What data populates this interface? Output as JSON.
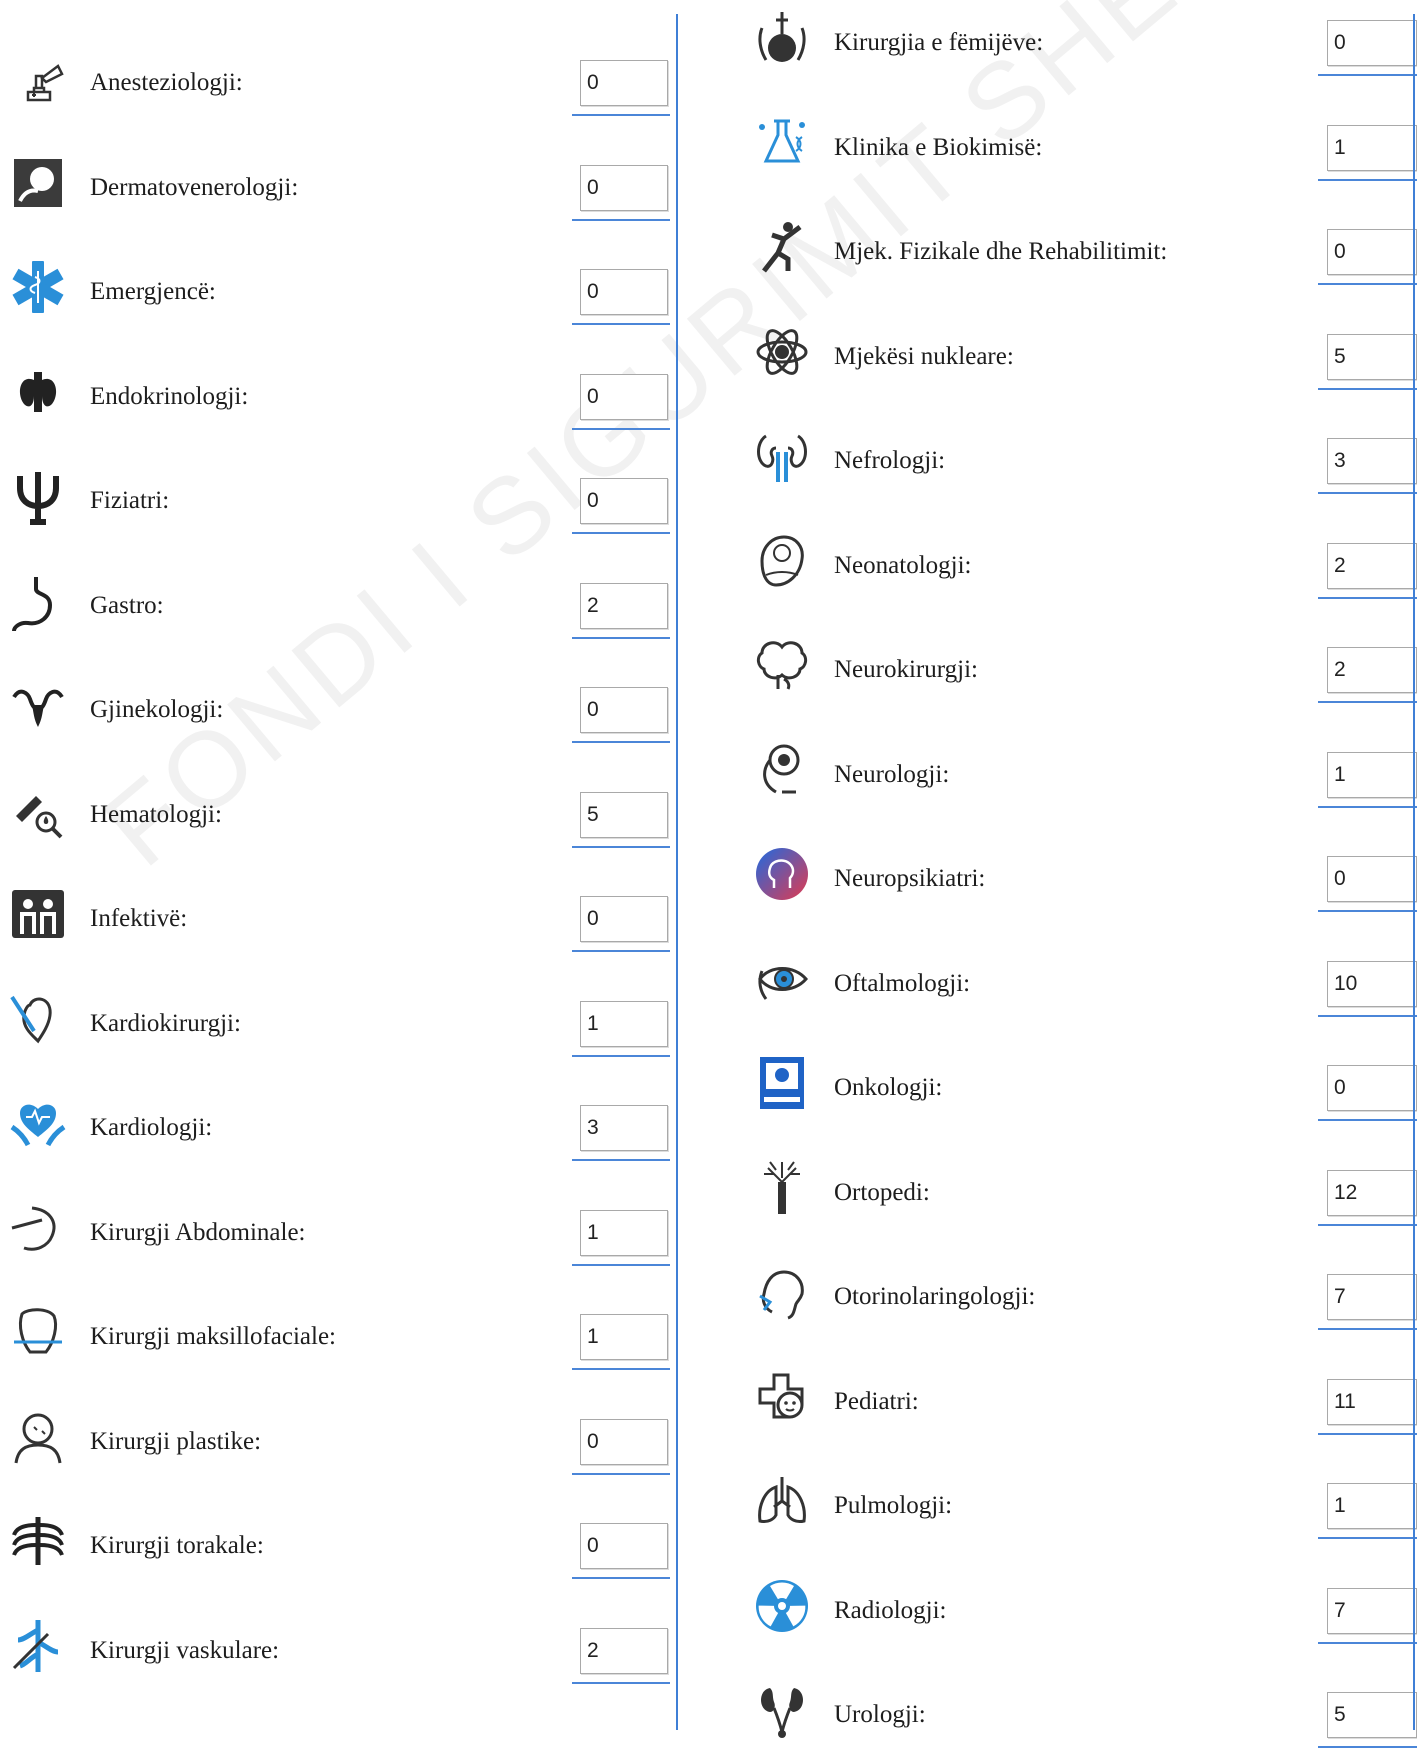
{
  "watermark": "FONDI I SIGURIMIT SHËNDETËSOR",
  "left": [
    {
      "label": "Anesteziologji:",
      "value": "0",
      "icon": "anesthesia-icon"
    },
    {
      "label": "Dermatovenerologji:",
      "value": "0",
      "icon": "dermatology-icon"
    },
    {
      "label": "Emergjencë:",
      "value": "0",
      "icon": "star-of-life-icon"
    },
    {
      "label": "Endokrinologji:",
      "value": "0",
      "icon": "thyroid-icon"
    },
    {
      "label": "Fiziatri:",
      "value": "0",
      "icon": "psi-icon"
    },
    {
      "label": "Gastro:",
      "value": "2",
      "icon": "stomach-icon"
    },
    {
      "label": "Gjinekologji:",
      "value": "0",
      "icon": "uterus-icon"
    },
    {
      "label": "Hematologji:",
      "value": "5",
      "icon": "blood-test-icon"
    },
    {
      "label": "Infektivë:",
      "value": "0",
      "icon": "infection-icon"
    },
    {
      "label": "Kardiokirurgji:",
      "value": "1",
      "icon": "heart-surgery-icon"
    },
    {
      "label": "Kardiologji:",
      "value": "3",
      "icon": "heart-hands-icon"
    },
    {
      "label": "Kirurgji Abdominale:",
      "value": "1",
      "icon": "abdominal-surgery-icon"
    },
    {
      "label": "Kirurgji maksillofaciale:",
      "value": "1",
      "icon": "jaw-icon"
    },
    {
      "label": "Kirurgji plastike:",
      "value": "0",
      "icon": "plastic-surgery-icon"
    },
    {
      "label": "Kirurgji torakale:",
      "value": "0",
      "icon": "ribcage-icon"
    },
    {
      "label": "Kirurgji vaskulare:",
      "value": "2",
      "icon": "vascular-icon"
    }
  ],
  "right": [
    {
      "label": "Kirurgjia e fëmijëve:",
      "value": "0",
      "icon": "pediatric-surgery-icon"
    },
    {
      "label": "Klinika e Biokimisë:",
      "value": "1",
      "icon": "biochemistry-icon"
    },
    {
      "label": "Mjek. Fizikale dhe Rehabilitimit:",
      "value": "0",
      "icon": "rehabilitation-icon"
    },
    {
      "label": "Mjekësi nukleare:",
      "value": "5",
      "icon": "nuclear-medicine-icon"
    },
    {
      "label": "Nefrologji:",
      "value": "3",
      "icon": "kidney-icon"
    },
    {
      "label": "Neonatologji:",
      "value": "2",
      "icon": "newborn-icon"
    },
    {
      "label": "Neurokirurgji:",
      "value": "2",
      "icon": "brain-icon"
    },
    {
      "label": "Neurologji:",
      "value": "1",
      "icon": "neurology-icon"
    },
    {
      "label": "Neuropsikiatri:",
      "value": "0",
      "icon": "neuropsychiatry-icon"
    },
    {
      "label": "Oftalmologji:",
      "value": "10",
      "icon": "eye-icon"
    },
    {
      "label": "Onkologji:",
      "value": "0",
      "icon": "oncology-icon"
    },
    {
      "label": "Ortopedi:",
      "value": "12",
      "icon": "bone-icon"
    },
    {
      "label": "Otorinolaringologji:",
      "value": "7",
      "icon": "ent-icon"
    },
    {
      "label": "Pediatri:",
      "value": "11",
      "icon": "pediatrics-icon"
    },
    {
      "label": "Pulmologji:",
      "value": "1",
      "icon": "lungs-icon"
    },
    {
      "label": "Radiologji:",
      "value": "7",
      "icon": "radiation-icon"
    },
    {
      "label": "Urologji:",
      "value": "5",
      "icon": "urology-icon"
    }
  ],
  "colors": {
    "rule": "#3f7fd6",
    "accent_blue": "#2a8fd8"
  }
}
